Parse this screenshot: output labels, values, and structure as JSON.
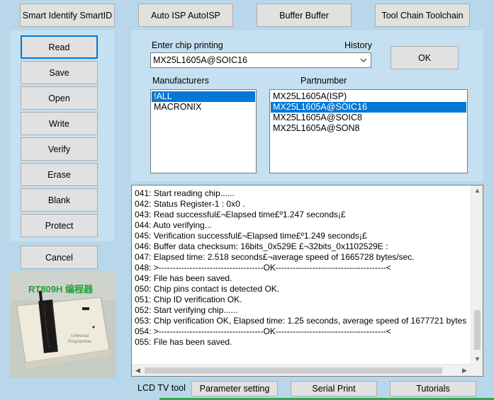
{
  "top_toolbar": {
    "smart_identify": "Smart Identify SmartID",
    "auto_isp": "Auto ISP AutoISP",
    "buffer": "Buffer Buffer",
    "tool_chain": "Tool Chain Toolchain"
  },
  "side_actions": {
    "read": "Read",
    "save": "Save",
    "open": "Open",
    "write": "Write",
    "verify": "Verify",
    "erase": "Erase",
    "blank": "Blank",
    "protect": "Protect",
    "cancel": "Cancel"
  },
  "chip_selector": {
    "enter_label": "Enter chip printing",
    "history_label": "History",
    "combo_value": "MX25L1605A@SOIC16",
    "ok_label": "OK",
    "manufacturers_label": "Manufacturers",
    "partnumber_label": "Partnumber",
    "manufacturers": [
      "!ALL",
      "MACRONIX"
    ],
    "manufacturers_selected": 0,
    "partnumbers": [
      "MX25L1605A(ISP)",
      "MX25L1605A@SOIC16",
      "MX25L1605A@SOIC8",
      "MX25L1605A@SON8"
    ],
    "partnumbers_selected": 1
  },
  "log": {
    "lines": [
      "041:  Start reading chip......",
      "042:  Status Register-1 : 0x0 .",
      "043:  Read successful£¬Elapsed time£º1.247 seconds¡£",
      "044:  Auto verifying...",
      "045:  Verification successful£¬Elapsed time£º1.249 seconds¡£",
      "046:  Buffer data checksum: 16bits_0x529E £¬32bits_0x1102529E :",
      "047:  Elapsed time: 2.518 seconds£¬average speed of 1665728 bytes/sec.",
      "048:  >-------------------------------------OK---------------------------------------<",
      "049:  File has been saved.",
      "050:  Chip pins contact is detected OK.",
      "051:  Chip ID verification OK.",
      "052:  Start verifying chip......",
      "053:  Chip verification OK, Elapsed time: 1.25 seconds, average speed of 1677721 bytes",
      "054:  >-------------------------------------OK---------------------------------------<",
      "055:  File has been saved."
    ]
  },
  "device": {
    "caption": "RT809H 编程器",
    "caption_color": "#1fa23a"
  },
  "bottom_bar": {
    "lcd_label": "LCD TV tool",
    "parameter_setting": "Parameter setting",
    "serial_print": "Serial Print",
    "tutorials": "Tutorials"
  },
  "colors": {
    "background": "#b9d7ea",
    "panel": "#c5e0f0",
    "selection": "#0078d7",
    "focus": "#0078d7"
  }
}
